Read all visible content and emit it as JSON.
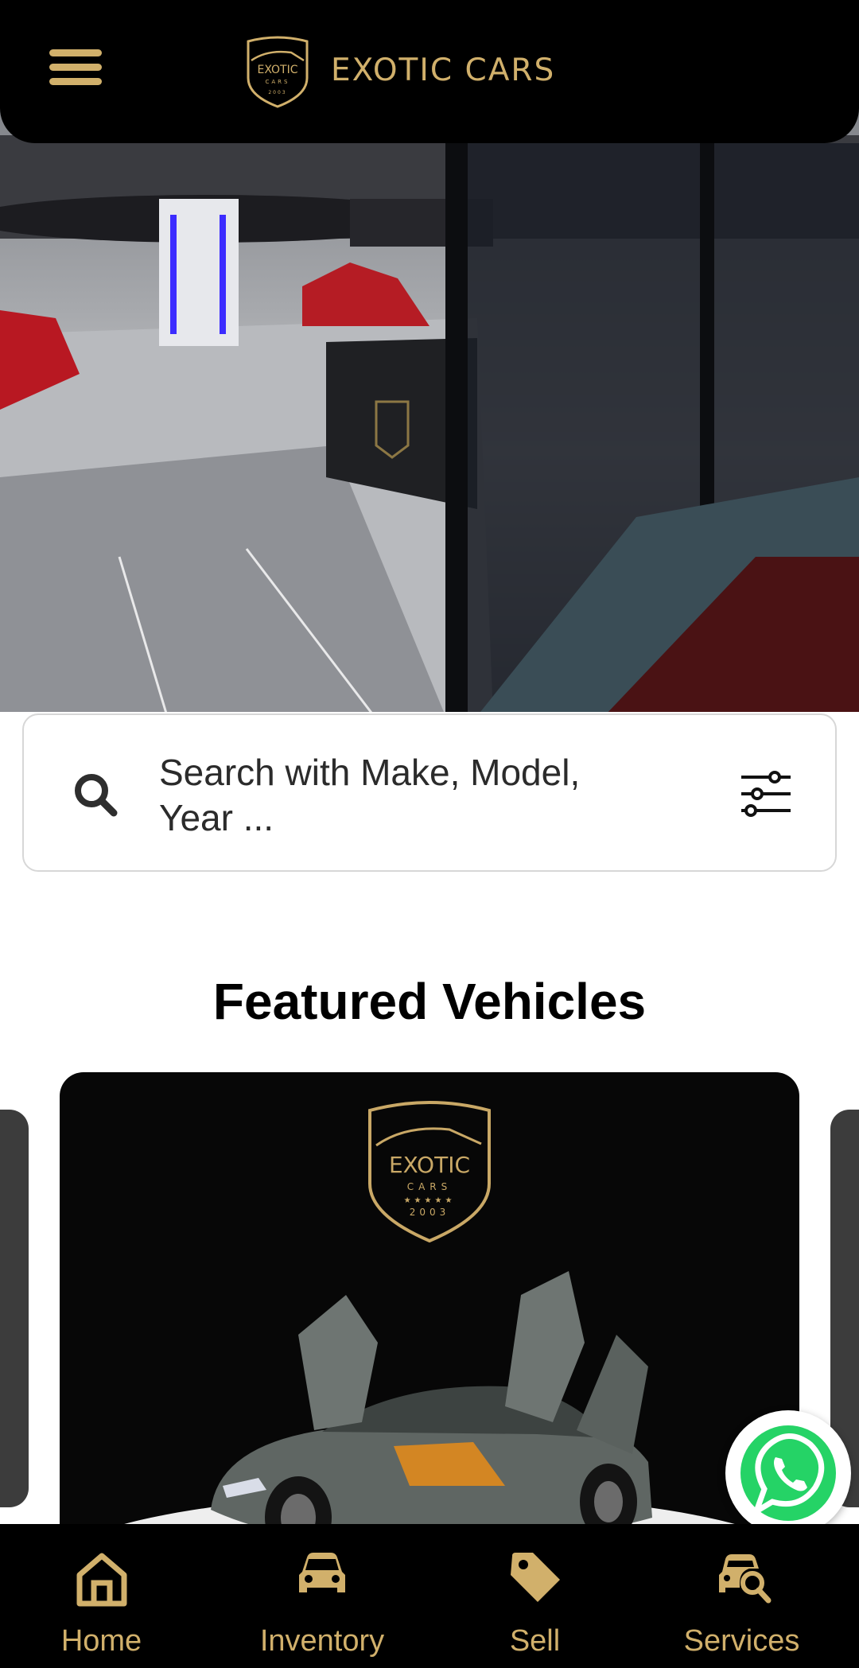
{
  "header": {
    "menu_icon": "hamburger-menu-icon",
    "brand_name": "EXOTIC CARS",
    "logo_text": "EXOTIC",
    "logo_sub": "CARS",
    "logo_year": "2003"
  },
  "search": {
    "placeholder": "Search with Make, Model, Year ...",
    "icon": "search-icon",
    "filter_icon": "filter-sliders-icon"
  },
  "featured": {
    "title": "Featured Vehicles",
    "card_logo_text": "EXOTIC",
    "card_logo_sub": "CARS",
    "card_logo_stars": "★★★★★",
    "card_logo_year": "2003"
  },
  "whatsapp": {
    "icon": "whatsapp-icon"
  },
  "nav": {
    "items": [
      {
        "label": "Home",
        "icon": "home-icon"
      },
      {
        "label": "Inventory",
        "icon": "car-icon"
      },
      {
        "label": "Sell",
        "icon": "tag-icon"
      },
      {
        "label": "Services",
        "icon": "car-search-icon"
      }
    ]
  },
  "colors": {
    "gold": "#d1b06b",
    "black": "#000000",
    "whatsapp_green": "#25d366"
  }
}
